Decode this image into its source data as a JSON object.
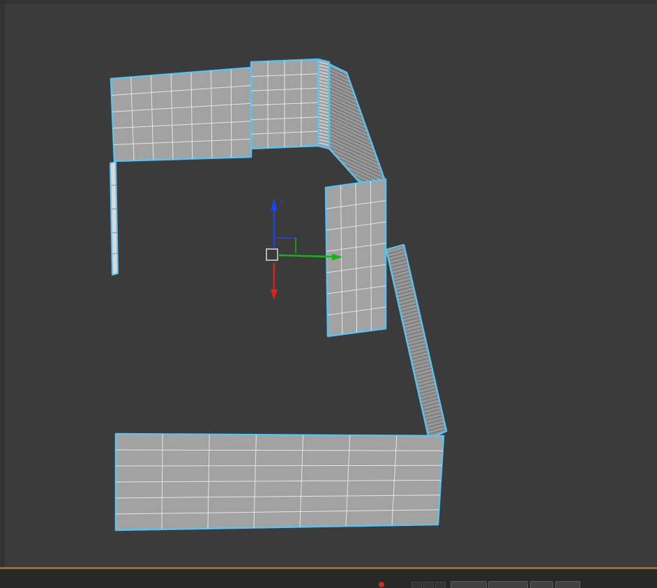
{
  "colors": {
    "viewport_bg": "#3b3b3b",
    "window_edge": "#2d2d2d",
    "wall_face": "#a2a2a2",
    "grid_line": "#ededed",
    "hatch_band_bg": "#979797",
    "hatch_side_bg": "#c2c2c2",
    "hatch_line": "#4a4a4a",
    "sliver_face": "#d9d9d9",
    "sliver_line": "#8a8a8a",
    "selection_outline": "#5cc1ee",
    "gizmo_x": "#e01f1f",
    "gizmo_y": "#17b317",
    "gizmo_z": "#2342ea",
    "gizmo_center": "#dcdcdc",
    "timeline_track": "#9d6e15",
    "statusbar_bg": "#272727",
    "statusbar_button": "#414141",
    "statusbar_button_edge": "#5d5d5d",
    "status_red_dot": "#c33523"
  },
  "gizmo": {
    "z_label": "z"
  },
  "statusbar": {
    "icons": [
      "red-dot-icon",
      "mini-icon",
      "mini-icon",
      "mini-icon"
    ]
  }
}
